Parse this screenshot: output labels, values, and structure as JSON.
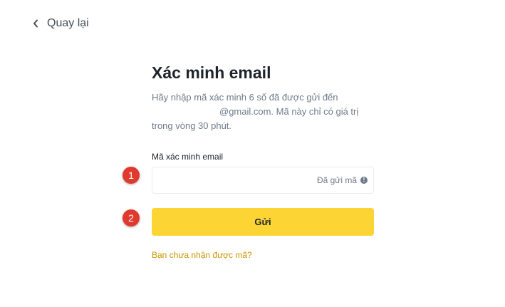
{
  "nav": {
    "back_label": "Quay lại",
    "back_icon": "chevron-left-icon"
  },
  "verify": {
    "title": "Xác minh email",
    "description_line1": "Hãy nhập mã xác minh 6 số đã được gửi đến",
    "description_line2": "@gmail.com. Mã này chỉ có giá trị",
    "description_line3": "trong vòng 30 phút.",
    "code_label": "Mã xác minh email",
    "code_value": "",
    "code_placeholder": "",
    "sent_status": "Đã gửi mã",
    "info_icon": "info-icon",
    "submit_label": "Gửi",
    "resend_link": "Bạn chưa nhận được mã?"
  },
  "annotations": {
    "marker1": "1",
    "marker2": "2"
  },
  "colors": {
    "accent": "#fcd535",
    "link": "#c99400",
    "marker": "#e03a2f",
    "muted_text": "#707a8a",
    "primary_text": "#1e2329"
  }
}
